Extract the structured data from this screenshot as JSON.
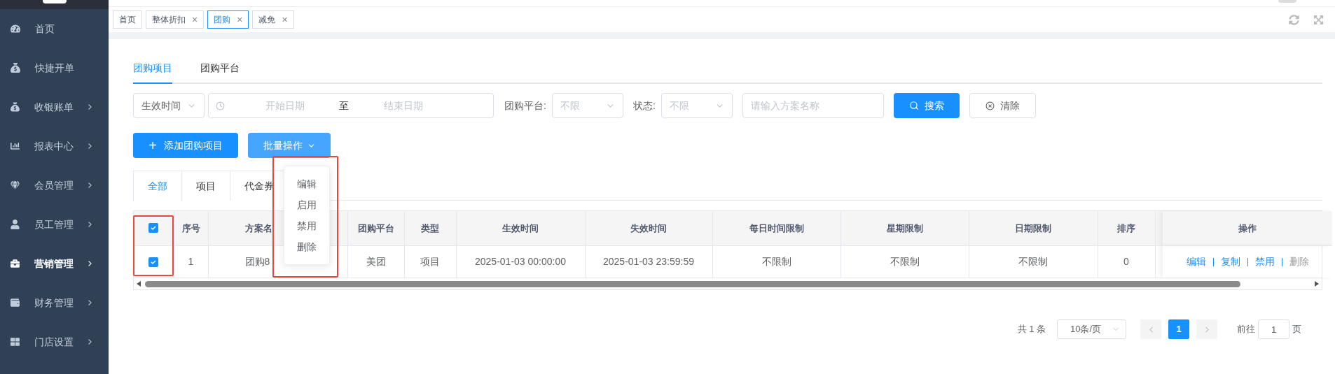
{
  "sidebar": {
    "items": [
      {
        "label": "首页",
        "selected": false,
        "expandable": false
      },
      {
        "label": "快捷开单",
        "selected": false,
        "expandable": false
      },
      {
        "label": "收银账单",
        "selected": false,
        "expandable": true
      },
      {
        "label": "报表中心",
        "selected": false,
        "expandable": true
      },
      {
        "label": "会员管理",
        "selected": false,
        "expandable": true
      },
      {
        "label": "员工管理",
        "selected": false,
        "expandable": true
      },
      {
        "label": "营销管理",
        "selected": true,
        "expandable": true
      },
      {
        "label": "财务管理",
        "selected": false,
        "expandable": true
      },
      {
        "label": "门店设置",
        "selected": false,
        "expandable": true
      }
    ]
  },
  "page_tabs": [
    {
      "label": "首页",
      "selected": false,
      "closable": false
    },
    {
      "label": "整体折扣",
      "selected": false,
      "closable": true,
      "close": "×"
    },
    {
      "label": "团购",
      "selected": true,
      "closable": true,
      "close": "×"
    },
    {
      "label": "减免",
      "selected": false,
      "closable": true,
      "close": "×"
    }
  ],
  "content_tabs": [
    {
      "label": "团购项目",
      "selected": true
    },
    {
      "label": "团购平台",
      "selected": false
    }
  ],
  "filters": {
    "time_type": "生效时间",
    "start_placeholder": "开始日期",
    "range_sep": "至",
    "end_placeholder": "结束日期",
    "platform_label": "团购平台:",
    "platform_value": "不限",
    "status_label": "状态:",
    "status_value": "不限",
    "name_placeholder": "请输入方案名称",
    "search_button": "搜索",
    "clear_button": "清除"
  },
  "add_button": {
    "icon": "+",
    "label": "添加团购项目"
  },
  "batch_button": "批量操作",
  "batch_menu": [
    "编辑",
    "启用",
    "禁用",
    "删除"
  ],
  "sub_tabs": [
    {
      "label": "全部",
      "selected": true
    },
    {
      "label": "项目",
      "selected": false
    },
    {
      "label": "代金券",
      "selected": false
    }
  ],
  "table": {
    "select_all": true,
    "columns": [
      "序号",
      "方案名",
      "团购平台",
      "类型",
      "生效时间",
      "失效时间",
      "每日时间限制",
      "星期限制",
      "日期限制",
      "排序",
      "操作"
    ],
    "rows": [
      {
        "checked": true,
        "cells": [
          "1",
          "团购8",
          "美团",
          "项目",
          "2025-01-03 00:00:00",
          "2025-01-03 23:59:59",
          "不限制",
          "不限制",
          "不限制",
          "0"
        ],
        "actions": [
          {
            "label": "编辑",
            "disabled": false
          },
          {
            "label": "复制",
            "disabled": false
          },
          {
            "label": "禁用",
            "disabled": false
          },
          {
            "label": "删除",
            "disabled": true
          }
        ]
      }
    ]
  },
  "pagination": {
    "total": "共 1 条",
    "page_size": "10条/页",
    "pages": [
      {
        "label": "1",
        "selected": true
      }
    ],
    "goto_label": "前往",
    "goto_value": "1",
    "goto_suffix": "页"
  }
}
